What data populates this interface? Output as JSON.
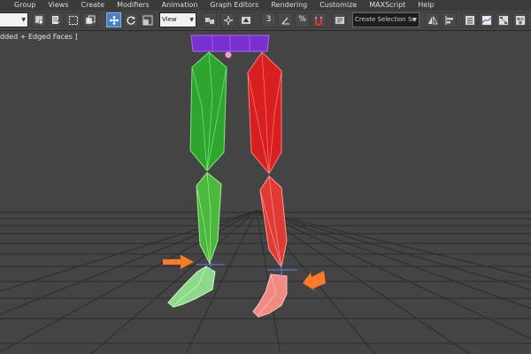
{
  "menu": {
    "items": [
      {
        "label": "Group"
      },
      {
        "label": "Views"
      },
      {
        "label": "Create"
      },
      {
        "label": "Modifiers"
      },
      {
        "label": "Animation"
      },
      {
        "label": "Graph Editors"
      },
      {
        "label": "Rendering"
      },
      {
        "label": "Customize"
      },
      {
        "label": "MAXScript"
      },
      {
        "label": "Help"
      }
    ]
  },
  "toolbar": {
    "reference_coord": "View",
    "selection_set_placeholder": "Create Selection Se",
    "snap_angle_label": "3",
    "percent_snap_label": "%"
  },
  "viewport": {
    "label": "dded + Edged Faces ]",
    "colors": {
      "background": "#444444",
      "grid": "#2c2c2c",
      "left_leg": "#2fb02f",
      "right_leg": "#e02222",
      "pelvis": "#7a2fd1",
      "arrow": "#ff7a2a"
    }
  },
  "icons": [
    "select-object-icon",
    "select-by-name-icon",
    "rect-selection-icon",
    "window-crossing-icon",
    "select-move-icon",
    "select-rotate-icon",
    "select-scale-icon",
    "pivot-center-icon",
    "select-manipulate-icon",
    "snap-toggle-icon",
    "angle-snap-icon",
    "percent-snap-icon",
    "spinner-snap-icon",
    "mirror-icon",
    "align-icon",
    "layer-manager-icon",
    "curve-editor-icon",
    "schematic-view-icon",
    "material-editor-icon",
    "render-setup-icon",
    "rendered-frame-icon",
    "render-icon"
  ]
}
